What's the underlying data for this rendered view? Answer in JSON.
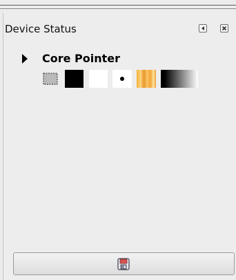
{
  "panel": {
    "title": "Device Status",
    "menu_icon": "tab-menu-icon",
    "close_icon": "close-icon"
  },
  "device": {
    "name": "Core Pointer",
    "expander_icon": "expander-triangle-icon",
    "status": {
      "tool_icon": "rectangle-select-icon",
      "foreground_color": "#000000",
      "background_color": "#ffffff",
      "brush": "round-brush-icon",
      "pattern": "orange-stripes-pattern",
      "gradient": "black-to-white-gradient"
    }
  },
  "footer": {
    "save_icon": "save-device-status-icon"
  }
}
